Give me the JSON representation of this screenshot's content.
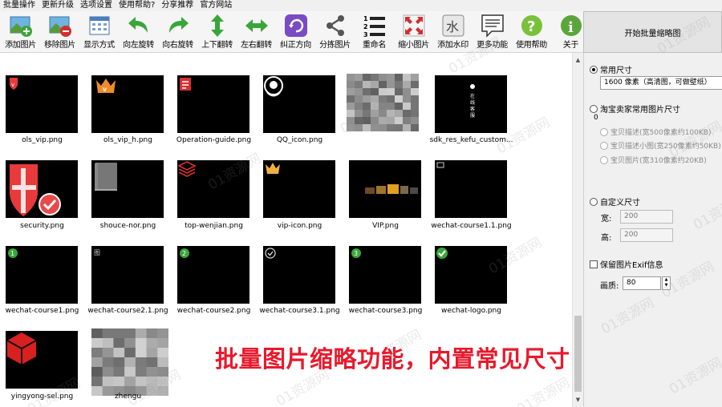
{
  "menu": [
    "批量操作",
    "更新升级",
    "选项设置",
    "使用帮助?",
    "分享推荐",
    "官方网站"
  ],
  "toolbar": [
    {
      "label": "添加图片",
      "icon": "add-image-icon"
    },
    {
      "label": "移除图片",
      "icon": "remove-image-icon"
    },
    {
      "label": "显示方式",
      "icon": "display-mode-icon"
    },
    {
      "label": "向左旋转",
      "icon": "rotate-left-icon"
    },
    {
      "label": "向右旋转",
      "icon": "rotate-right-icon"
    },
    {
      "label": "上下翻转",
      "icon": "flip-vertical-icon"
    },
    {
      "label": "左右翻转",
      "icon": "flip-horizontal-icon"
    },
    {
      "label": "纠正方向",
      "icon": "correct-orientation-icon"
    },
    {
      "label": "分拣图片",
      "icon": "sort-images-icon"
    },
    {
      "label": "重命名",
      "icon": "rename-icon"
    },
    {
      "label": "缩小图片",
      "icon": "shrink-image-icon"
    },
    {
      "label": "添加水印",
      "icon": "watermark-icon"
    },
    {
      "label": "更多功能",
      "icon": "more-features-icon"
    },
    {
      "label": "使用帮助",
      "icon": "help-icon"
    },
    {
      "label": "关于",
      "icon": "about-icon"
    }
  ],
  "start_button": "开始批量缩略图",
  "images": [
    {
      "name": "ols_vip.png",
      "art": "shield-v"
    },
    {
      "name": "ols_vip_h.png",
      "art": "crown"
    },
    {
      "name": "Operation-guide.png",
      "art": "guide"
    },
    {
      "name": "QQ_icon.png",
      "art": "qq"
    },
    {
      "name": "",
      "art": "mosaic"
    },
    {
      "name": "sdk_res_kefu_custom...",
      "art": "kefu"
    },
    {
      "name": "security.png",
      "art": "security"
    },
    {
      "name": "shouce-nor.png",
      "art": "book"
    },
    {
      "name": "top-wenjian.png",
      "art": "layers"
    },
    {
      "name": "vip-icon.png",
      "art": "crown-small"
    },
    {
      "name": "VIP.png",
      "art": "vip-bar"
    },
    {
      "name": "wechat-course1.1.png",
      "art": "rect"
    },
    {
      "name": "wechat-course1.png",
      "art": "num-1"
    },
    {
      "name": "wechat-course2.1.png",
      "art": "mark"
    },
    {
      "name": "wechat-course2.png",
      "art": "num-2"
    },
    {
      "name": "wechat-course3.1.png",
      "art": "check-outline"
    },
    {
      "name": "wechat-course3.png",
      "art": "num-3"
    },
    {
      "name": "wechat-logo.png",
      "art": "check-green"
    },
    {
      "name": "yingyong-sel.png",
      "art": "cube"
    },
    {
      "name": "zhengu",
      "art": "mosaic2"
    }
  ],
  "kefu_text": "在线客服",
  "panel": {
    "common_size_label": "常用尺寸",
    "common_size_value": "1600 像素（高清图，可做壁纸）",
    "taobao_label": "淘宝卖家常用图片尺寸",
    "taobao_sub": "0",
    "taobao_options": [
      "宝贝描述(宽500像素约100KB)",
      "宝贝描述小图(宽250像素约50KB)",
      "宝贝图片(宽310像素约20KB)"
    ],
    "custom_label": "自定义尺寸",
    "width_label": "宽:",
    "width_value": "200",
    "height_label": "高:",
    "height_value": "200",
    "exif_label": "保留图片Exif信息",
    "quality_label": "画质:",
    "quality_value": "80"
  },
  "promo_text": "批量图片缩略功能，内置常见尺寸",
  "watermark_text": "01资源网",
  "colors": {
    "accent_red": "#e8192c",
    "shield_red": "#e83a3a",
    "orange": "#f08c2a",
    "green": "#3aa63a"
  }
}
